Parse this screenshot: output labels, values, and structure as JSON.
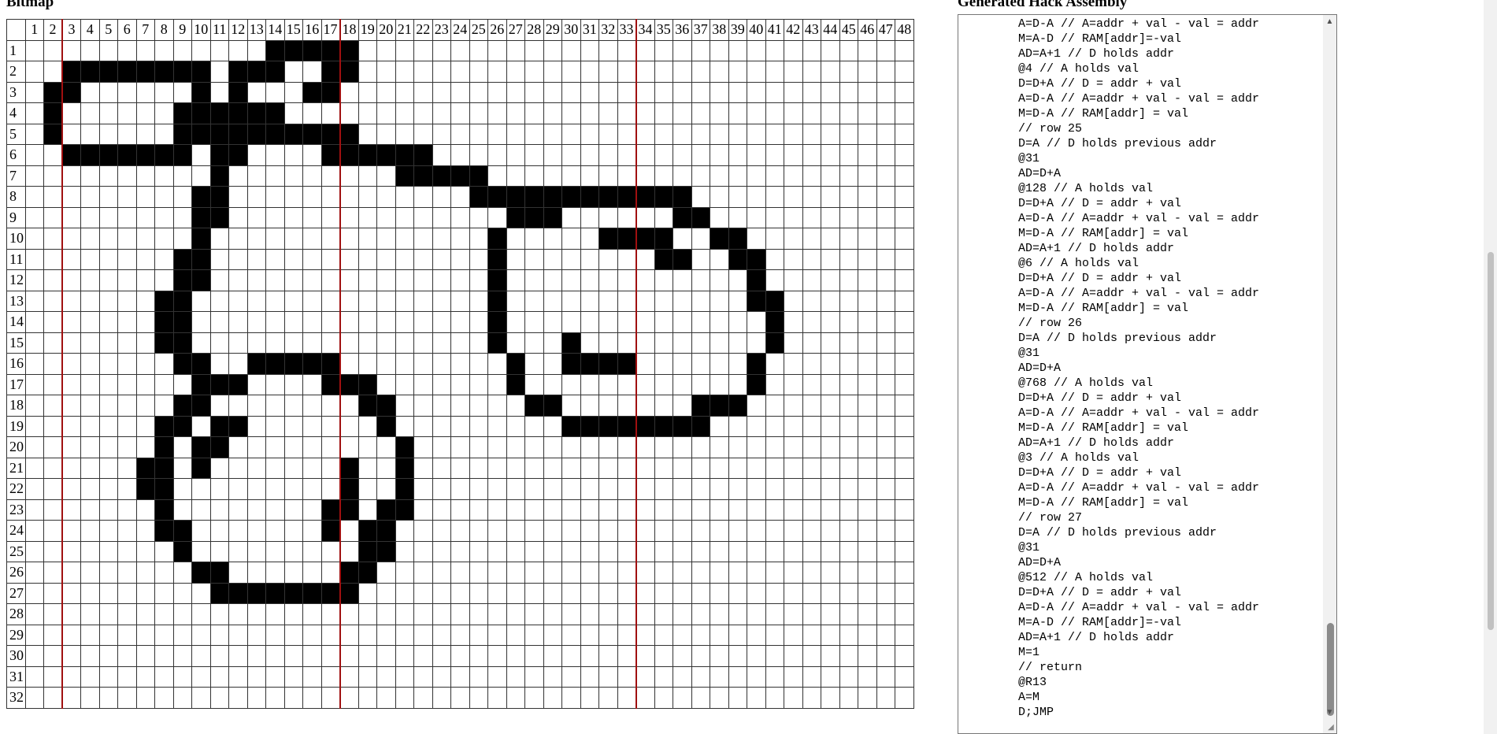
{
  "headings": {
    "bitmap": "Bitmap",
    "assembly": "Generated Hack Assembly"
  },
  "grid": {
    "column_labels": [
      "1",
      "2",
      "3",
      "4",
      "5",
      "6",
      "7",
      "8",
      "9",
      "10",
      "11",
      "12",
      "13",
      "14",
      "15",
      "16",
      "17",
      "18",
      "19",
      "20",
      "21",
      "22",
      "23",
      "24",
      "25",
      "26",
      "27",
      "28",
      "29",
      "30",
      "31",
      "32",
      "33",
      "34",
      "35",
      "36",
      "37",
      "38",
      "39",
      "40",
      "41",
      "42",
      "43",
      "44",
      "45",
      "46",
      "47",
      "48"
    ],
    "row_labels": [
      "1",
      "2",
      "3",
      "4",
      "5",
      "6",
      "7",
      "8",
      "9",
      "10",
      "11",
      "12",
      "13",
      "14",
      "15",
      "16",
      "17",
      "18",
      "19",
      "20",
      "21",
      "22",
      "23",
      "24",
      "25",
      "26",
      "27",
      "28",
      "29",
      "30",
      "31",
      "32"
    ],
    "separator_columns": [
      2,
      17,
      33
    ],
    "filled": [
      [
        14,
        15,
        16,
        17,
        18
      ],
      [
        3,
        4,
        5,
        6,
        7,
        8,
        9,
        10,
        12,
        13,
        14,
        17,
        18
      ],
      [
        2,
        3,
        10,
        12,
        16,
        17
      ],
      [
        2,
        9,
        10,
        11,
        12,
        13,
        14
      ],
      [
        2,
        9,
        10,
        11,
        12,
        13,
        14,
        15,
        16,
        17,
        18
      ],
      [
        3,
        4,
        5,
        6,
        7,
        8,
        9,
        11,
        12,
        17,
        18,
        19,
        20,
        21,
        22
      ],
      [
        11,
        21,
        22,
        23,
        24,
        25
      ],
      [
        10,
        11,
        25,
        26,
        27,
        28,
        29,
        30,
        31,
        32,
        33,
        34,
        35,
        36
      ],
      [
        10,
        11,
        27,
        28,
        29,
        36,
        37
      ],
      [
        10,
        26,
        32,
        33,
        34,
        35,
        38,
        39
      ],
      [
        9,
        10,
        26,
        35,
        36,
        39,
        40
      ],
      [
        9,
        10,
        26,
        40
      ],
      [
        8,
        9,
        26,
        40,
        41
      ],
      [
        8,
        9,
        26,
        41
      ],
      [
        8,
        9,
        26,
        30,
        41
      ],
      [
        9,
        10,
        13,
        14,
        15,
        16,
        17,
        27,
        30,
        31,
        32,
        33,
        40
      ],
      [
        10,
        11,
        12,
        17,
        18,
        19,
        27,
        40
      ],
      [
        9,
        10,
        19,
        20,
        28,
        29,
        37,
        38,
        39
      ],
      [
        8,
        9,
        11,
        12,
        20,
        30,
        31,
        32,
        33,
        34,
        35,
        36,
        37
      ],
      [
        8,
        10,
        11,
        21
      ],
      [
        7,
        8,
        10,
        18,
        21
      ],
      [
        7,
        8,
        18,
        21
      ],
      [
        8,
        17,
        18,
        20,
        21
      ],
      [
        8,
        9,
        17,
        19,
        20
      ],
      [
        9,
        19,
        20
      ],
      [
        10,
        11,
        18,
        19
      ],
      [
        11,
        12,
        13,
        14,
        15,
        16,
        17,
        18
      ],
      [],
      [],
      [],
      [],
      []
    ]
  },
  "assembly": {
    "lines": [
      "A=D-A // A=addr + val - val = addr",
      "M=A-D // RAM[addr]=-val",
      "AD=A+1 // D holds addr",
      "@4 // A holds val",
      "D=D+A // D = addr + val",
      "A=D-A // A=addr + val - val = addr",
      "M=D-A // RAM[addr] = val",
      "// row 25",
      "D=A // D holds previous addr",
      "@31",
      "AD=D+A",
      "@128 // A holds val",
      "D=D+A // D = addr + val",
      "A=D-A // A=addr + val - val = addr",
      "M=D-A // RAM[addr] = val",
      "AD=A+1 // D holds addr",
      "@6 // A holds val",
      "D=D+A // D = addr + val",
      "A=D-A // A=addr + val - val = addr",
      "M=D-A // RAM[addr] = val",
      "// row 26",
      "D=A // D holds previous addr",
      "@31",
      "AD=D+A",
      "@768 // A holds val",
      "D=D+A // D = addr + val",
      "A=D-A // A=addr + val - val = addr",
      "M=D-A // RAM[addr] = val",
      "AD=A+1 // D holds addr",
      "@3 // A holds val",
      "D=D+A // D = addr + val",
      "A=D-A // A=addr + val - val = addr",
      "M=D-A // RAM[addr] = val",
      "// row 27",
      "D=A // D holds previous addr",
      "@31",
      "AD=D+A",
      "@512 // A holds val",
      "D=D+A // D = addr + val",
      "A=D-A // A=addr + val - val = addr",
      "M=A-D // RAM[addr]=-val",
      "AD=A+1 // D holds addr",
      "M=1",
      "// return",
      "@R13",
      "A=M",
      "D;JMP"
    ]
  },
  "icons": {
    "scroll_up": "chevron-up-icon",
    "scroll_down": "chevron-down-icon",
    "resize": "resize-grip-icon"
  }
}
